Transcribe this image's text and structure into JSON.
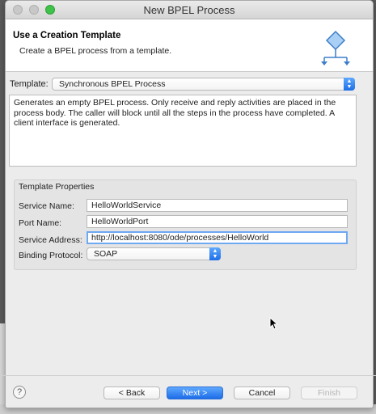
{
  "window": {
    "title": "New BPEL Process"
  },
  "header": {
    "title": "Use a Creation Template",
    "description": "Create a BPEL process from a template."
  },
  "template": {
    "label": "Template:",
    "selected": "Synchronous BPEL Process",
    "description": "Generates an empty BPEL process. Only receive and reply activities are placed in the process body. The caller will block until all the steps in the process have completed. A client interface is generated."
  },
  "properties": {
    "group_title": "Template Properties",
    "service_name_label": "Service Name:",
    "service_name_value": "HelloWorldService",
    "port_name_label": "Port Name:",
    "port_name_value": "HelloWorldPort",
    "service_address_label": "Service Address:",
    "service_address_value": "http://localhost:8080/ode/processes/HelloWorld",
    "binding_protocol_label": "Binding Protocol:",
    "binding_protocol_value": "SOAP"
  },
  "buttons": {
    "help": "?",
    "back": "< Back",
    "next": "Next >",
    "cancel": "Cancel",
    "finish": "Finish"
  },
  "colors": {
    "accent": "#1c6ce8",
    "focus": "#6fa8f3",
    "close_zoom": "#3fc24a"
  },
  "icons": [
    "help-icon",
    "wizard-diamond-icon",
    "dropdown-arrows-icon",
    "mouse-pointer-icon"
  ]
}
